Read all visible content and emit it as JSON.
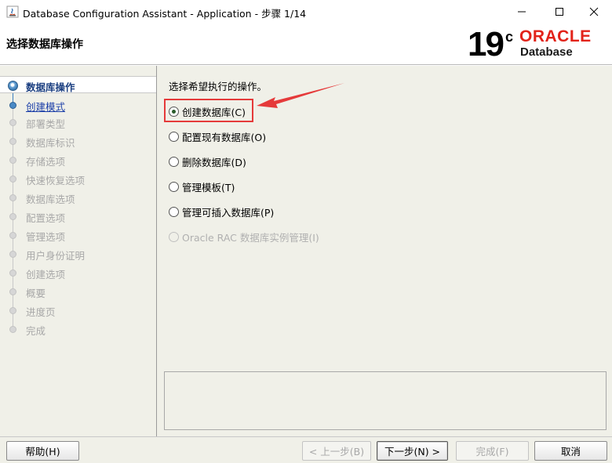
{
  "window": {
    "title": "Database Configuration Assistant - Application - 步骤 1/14"
  },
  "header": {
    "title": "选择数据库操作",
    "logo_version": "19",
    "logo_superscript": "c",
    "logo_brand": "ORACLE",
    "logo_product": "Database"
  },
  "steps": [
    {
      "label": "数据库操作",
      "state": "current"
    },
    {
      "label": "创建模式",
      "state": "next"
    },
    {
      "label": "部署类型",
      "state": "disabled"
    },
    {
      "label": "数据库标识",
      "state": "disabled"
    },
    {
      "label": "存储选项",
      "state": "disabled"
    },
    {
      "label": "快速恢复选项",
      "state": "disabled"
    },
    {
      "label": "数据库选项",
      "state": "disabled"
    },
    {
      "label": "配置选项",
      "state": "disabled"
    },
    {
      "label": "管理选项",
      "state": "disabled"
    },
    {
      "label": "用户身份证明",
      "state": "disabled"
    },
    {
      "label": "创建选项",
      "state": "disabled"
    },
    {
      "label": "概要",
      "state": "disabled"
    },
    {
      "label": "进度页",
      "state": "disabled"
    },
    {
      "label": "完成",
      "state": "disabled"
    }
  ],
  "main": {
    "prompt": "选择希望执行的操作。",
    "options": [
      {
        "label": "创建数据库(C)",
        "checked": true,
        "enabled": true
      },
      {
        "label": "配置现有数据库(O)",
        "checked": false,
        "enabled": true
      },
      {
        "label": "删除数据库(D)",
        "checked": false,
        "enabled": true
      },
      {
        "label": "管理模板(T)",
        "checked": false,
        "enabled": true
      },
      {
        "label": "管理可插入数据库(P)",
        "checked": false,
        "enabled": true
      },
      {
        "label": "Oracle RAC 数据库实例管理(I)",
        "checked": false,
        "enabled": false
      }
    ]
  },
  "footer": {
    "help": "帮助(H)",
    "back": "< 上一步(B)",
    "next": "下一步(N) >",
    "finish": "完成(F)",
    "cancel": "取消"
  },
  "colors": {
    "annotation_red": "#e53a3a",
    "oracle_red": "#e2231a"
  }
}
